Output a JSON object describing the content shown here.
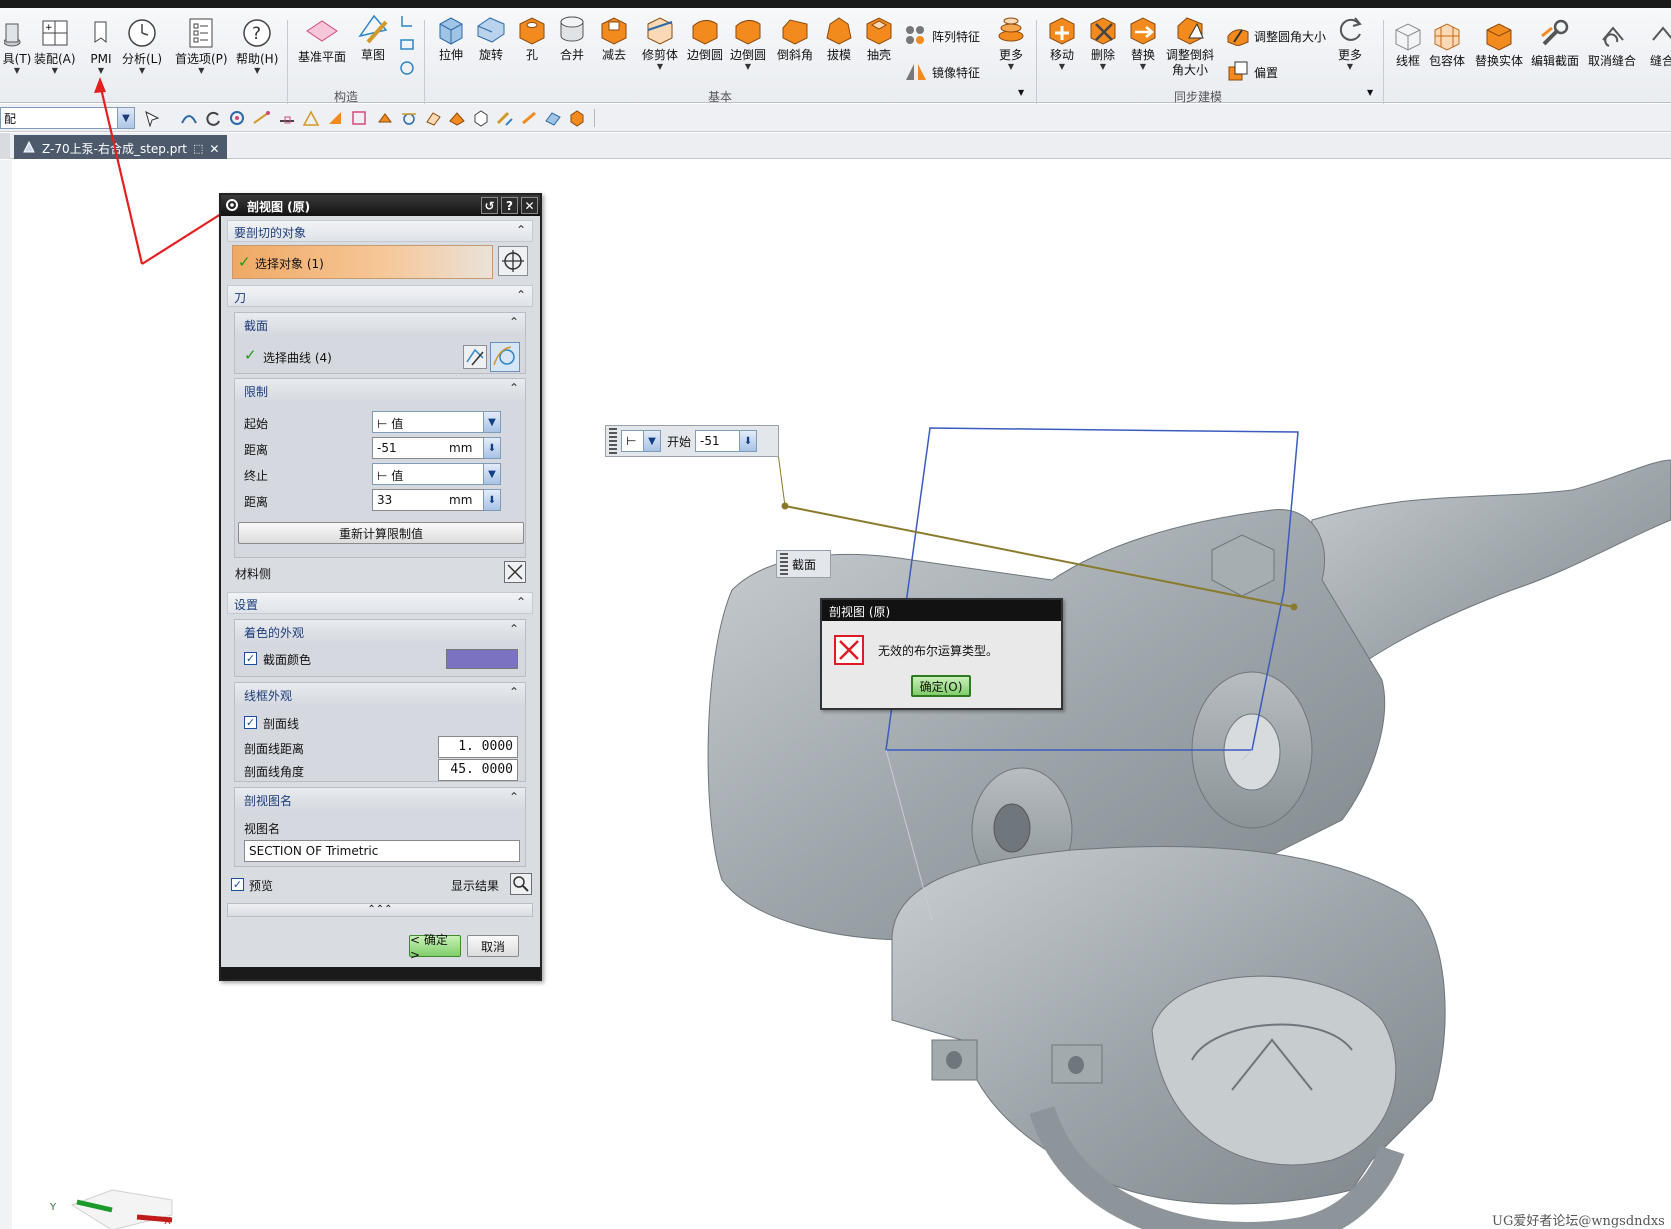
{
  "ribbon": {
    "left_menu": [
      {
        "label": "具(T)"
      },
      {
        "label": "装配(A)"
      },
      {
        "label": "PMI"
      },
      {
        "label": "分析(L)"
      },
      {
        "label": "首选项(P)"
      },
      {
        "label": "帮助(H)"
      }
    ],
    "construct": {
      "datum_plane": "基准平面",
      "sketch": "草图",
      "group_label": "构造"
    },
    "basic": {
      "extrude": "拉伸",
      "revolve": "旋转",
      "hole": "孔",
      "unite": "合并",
      "subtract": "减去",
      "trim_body": "修剪体",
      "edge_blend": "边倒圆",
      "edge_blend2": "边倒圆",
      "chamfer": "倒斜角",
      "draft": "拔模",
      "shell": "抽壳",
      "pattern_feature": "阵列特征",
      "mirror_feature": "镜像特征",
      "more": "更多",
      "group_label": "基本"
    },
    "sync": {
      "move": "移动",
      "delete": "删除",
      "replace": "替换",
      "resize_chamfer_1": "调整倒斜",
      "resize_chamfer_2": "角大小",
      "resize_blend": "调整圆角大小",
      "offset": "偏置",
      "more": "更多",
      "group_label": "同步建模"
    },
    "right": {
      "wireframe": "线框",
      "wrap": "包容体",
      "replace_solid": "替换实体",
      "edit_section": "编辑截面",
      "unsew": "取消缝合",
      "sew": "缝合"
    }
  },
  "toolbar2": {
    "filter_value": "配"
  },
  "tab": {
    "label": "Z-70上泵-右合成_step.prt"
  },
  "dialog": {
    "title": "剖视图 (原)",
    "section_object": "要剖切的对象",
    "select_object": "选择对象 (1)",
    "knife": "刀",
    "section_panel": "截面",
    "select_curve": "选择曲线 (4)",
    "limits_panel": "限制",
    "start_label": "起始",
    "start_value": "值",
    "distance_label": "距离",
    "start_distance": "-51",
    "unit": "mm",
    "end_label": "终止",
    "end_value": "值",
    "distance_label2": "距离",
    "end_distance": "33",
    "unit2": "mm",
    "recompute": "重新计算限制值",
    "material_side": "材料侧",
    "settings": "设置",
    "shaded_panel": "着色的外观",
    "section_color": "截面颜色",
    "section_color_hex": "#7b72c2",
    "wire_panel": "线框外观",
    "hatch": "剖面线",
    "hatch_distance_label": "剖面线距离",
    "hatch_distance": "1. 0000",
    "hatch_angle_label": "剖面线角度",
    "hatch_angle": "45. 0000",
    "view_name_panel": "剖视图名",
    "view_name_label": "视图名",
    "view_name": "SECTION OF Trimetric",
    "preview": "预览",
    "show_result": "显示结果",
    "ok": "< 确定 >",
    "cancel": "取消"
  },
  "float_start": {
    "label": "开始",
    "value": "-51"
  },
  "float_section": {
    "label": "截面"
  },
  "error": {
    "title": "剖视图 (原)",
    "message": "无效的布尔运算类型。",
    "ok": "确定(O)"
  },
  "axes": {
    "y": "Y",
    "x": "X"
  },
  "watermark": "UG爱好者论坛@wngsdndxs",
  "colors": {
    "accent_orange": "#f28a1e",
    "part_gray": "#a9b0b5",
    "error_red": "#e01b24"
  }
}
